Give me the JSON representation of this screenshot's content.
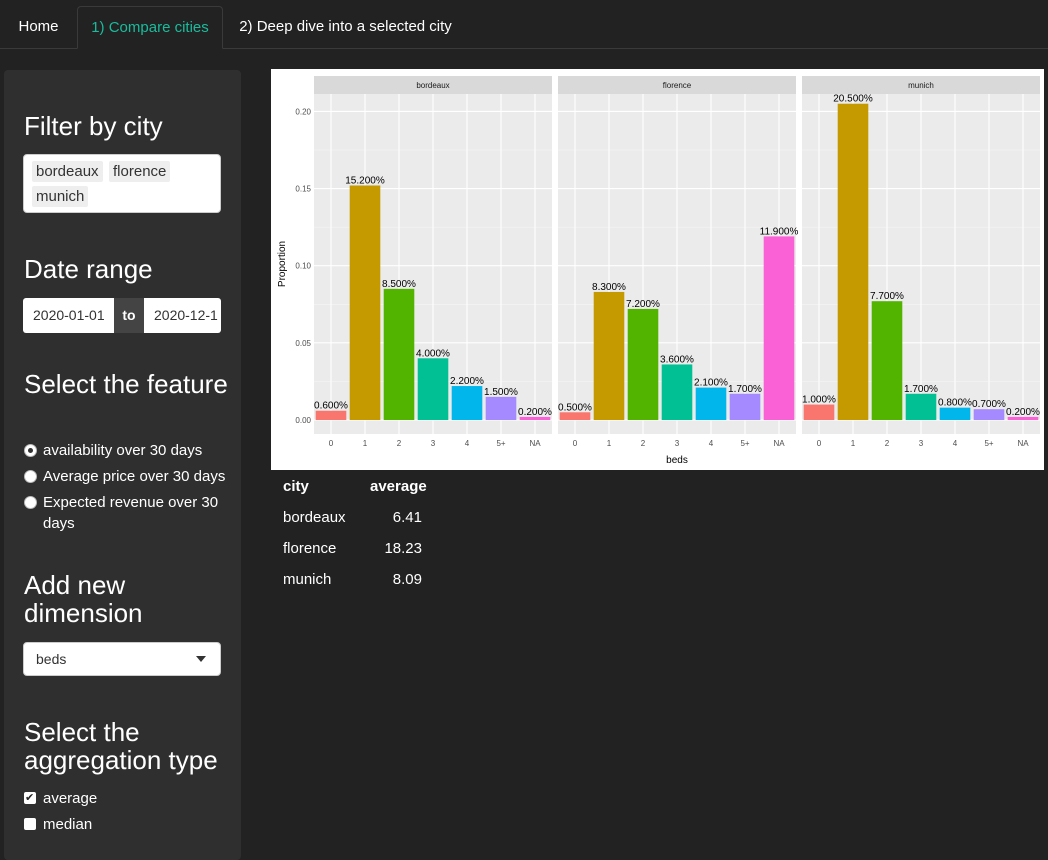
{
  "tabs": {
    "home": "Home",
    "compare": "1) Compare cities",
    "deep": "2) Deep dive into a selected city"
  },
  "sidebar": {
    "filter_heading": "Filter by city",
    "cities": [
      "bordeaux",
      "florence",
      "munich"
    ],
    "date_heading": "Date range",
    "date_start": "2020-01-01",
    "date_to": "to",
    "date_end": "2020-12-1",
    "feature_heading": "Select the feature",
    "features": [
      {
        "label": "availability over 30 days",
        "selected": true
      },
      {
        "label": "Average price over 30 days",
        "selected": false
      },
      {
        "label": "Expected revenue over 30 days",
        "selected": false
      }
    ],
    "dimension_heading": "Add new dimension",
    "dimension_value": "beds",
    "aggregation_heading": "Select the aggregation type",
    "aggregations": [
      {
        "label": "average",
        "checked": true
      },
      {
        "label": "median",
        "checked": false
      }
    ]
  },
  "colors": {
    "accent": "#18bc9c",
    "background": "#222222",
    "sidebar": "#2f2f2f"
  },
  "chart_data": {
    "type": "bar",
    "xlabel": "beds",
    "ylabel": "Proportion",
    "ylim": [
      0,
      0.21
    ],
    "yticks": [
      "0.00",
      "0.05",
      "0.10",
      "0.15",
      "0.20"
    ],
    "categories": [
      "0",
      "1",
      "2",
      "3",
      "4",
      "5+",
      "NA"
    ],
    "category_colors": [
      "#F8766D",
      "#C49A00",
      "#53B400",
      "#00C094",
      "#00B6EB",
      "#A58AFF",
      "#FB61D7"
    ],
    "facets": [
      {
        "name": "bordeaux",
        "values": [
          0.006,
          0.152,
          0.085,
          0.04,
          0.022,
          0.015,
          0.002
        ],
        "labels": [
          "0.600%",
          "15.200%",
          "8.500%",
          "4.000%",
          "2.200%",
          "1.500%",
          "0.200%"
        ]
      },
      {
        "name": "florence",
        "values": [
          0.005,
          0.083,
          0.072,
          0.036,
          0.021,
          0.017,
          0.119
        ],
        "labels": [
          "0.500%",
          "8.300%",
          "7.200%",
          "3.600%",
          "2.100%",
          "1.700%",
          "11.900%"
        ]
      },
      {
        "name": "munich",
        "values": [
          0.01,
          0.205,
          0.077,
          0.017,
          0.008,
          0.007,
          0.002
        ],
        "labels": [
          "1.000%",
          "20.500%",
          "7.700%",
          "1.700%",
          "0.800%",
          "0.700%",
          "0.200%"
        ]
      }
    ]
  },
  "table": {
    "headers": [
      "city",
      "average"
    ],
    "rows": [
      [
        "bordeaux",
        "6.41"
      ],
      [
        "florence",
        "18.23"
      ],
      [
        "munich",
        "8.09"
      ]
    ]
  }
}
